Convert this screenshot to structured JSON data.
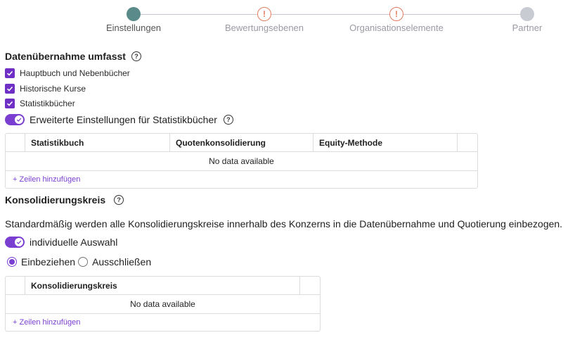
{
  "stepper": {
    "steps": [
      {
        "label": "Einstellungen",
        "state": "active"
      },
      {
        "label": "Bewertungsebenen",
        "state": "warning"
      },
      {
        "label": "Organisationselemente",
        "state": "warning"
      },
      {
        "label": "Partner",
        "state": "idle"
      }
    ],
    "warning_glyph": "!"
  },
  "datenuebernahme": {
    "title": "Datenübernahme umfasst",
    "help_glyph": "?",
    "checkboxes": [
      {
        "label": "Hauptbuch und Nebenbücher",
        "checked": true
      },
      {
        "label": "Historische Kurse",
        "checked": true
      },
      {
        "label": "Statistikbücher",
        "checked": true
      }
    ],
    "toggle_label": "Erweiterte Einstellungen für Statistikbücher",
    "toggle_on": true,
    "table": {
      "columns": [
        "Statistikbuch",
        "Quotenkonsolidierung",
        "Equity-Methode"
      ],
      "empty_text": "No data available",
      "add_rows_label": "+ Zeilen hinzufügen"
    }
  },
  "konsolidierungskreis": {
    "title": "Konsolidierungskreis",
    "help_glyph": "?",
    "description": "Standardmäßig werden alle Konsolidierungskreise innerhalb des Konzerns in die Datenübernahme und Quotierung einbezogen.",
    "toggle_label": "individuelle Auswahl",
    "toggle_on": true,
    "radios": [
      {
        "label": "Einbeziehen",
        "checked": true
      },
      {
        "label": "Ausschließen",
        "checked": false
      }
    ],
    "table": {
      "columns": [
        "Konsolidierungskreis"
      ],
      "empty_text": "No data available",
      "add_rows_label": "+ Zeilen hinzufügen"
    }
  },
  "colors": {
    "accent": "#7a3fd0",
    "step_active": "#5b8a8a",
    "step_warning": "#e07b5f",
    "step_idle": "#c8cbd2"
  }
}
